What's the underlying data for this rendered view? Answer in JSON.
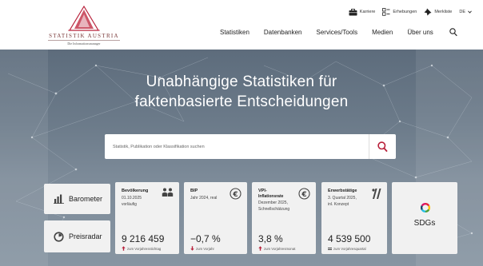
{
  "header": {
    "logo": {
      "wordmark": "STATISTIK AUSTRIA",
      "tagline": "Die Informationsmanager"
    },
    "utility": [
      {
        "label": "Karriere",
        "icon": "briefcase-icon"
      },
      {
        "label": "Erhebungen",
        "icon": "survey-icon"
      },
      {
        "label": "Merkliste",
        "icon": "pin-icon"
      },
      {
        "label": "DE",
        "icon": "chevron-down-icon"
      }
    ],
    "nav": [
      "Statistiken",
      "Datenbanken",
      "Services/Tools",
      "Medien",
      "Über uns"
    ],
    "search_icon": "search-icon"
  },
  "hero": {
    "title_line1": "Unabhängige Statistiken für",
    "title_line2": "faktenbasierte Entscheidungen",
    "search_placeholder": "Statistik, Publikation oder Klassifikation suchen"
  },
  "side_cards": {
    "barometer": {
      "label": "Barometer",
      "icon": "bar-chart-icon"
    },
    "preisradar": {
      "label": "Preisradar",
      "icon": "radar-icon"
    }
  },
  "kpis": [
    {
      "title": "Bevölkerung",
      "sub1": "01.10.2025",
      "sub2": "vorläufig",
      "sub3": "",
      "value": "9 216 459",
      "footer": "zum Vorjahresstichtag",
      "trend": "up",
      "icon": "people-icon"
    },
    {
      "title": "BIP",
      "sub1": "Jahr 2024, real",
      "sub2": "",
      "sub3": "",
      "value": "−0,7 %",
      "footer": "zum Vorjahr",
      "trend": "down",
      "icon": "euro-icon"
    },
    {
      "title": "VPI-",
      "sub1": "Inflationsrate",
      "sub2": "Dezember 2025,",
      "sub3": "Schnellschätzung",
      "value": "3,8 %",
      "footer": "zum Vorjahresmonat",
      "trend": "up",
      "icon": "euro-icon"
    },
    {
      "title": "Erwerbstätige",
      "sub1": "3. Quartal 2025,",
      "sub2": "inl. Konzept",
      "sub3": "",
      "value": "4 539 500",
      "footer": "zum Vorjahresquartal",
      "trend": "equal",
      "icon": "worker-icon"
    }
  ],
  "sdg": {
    "label": "SDGs",
    "icon": "sdg-wheel-icon"
  },
  "colors": {
    "accent": "#b8203a",
    "hero_top": "#5d6c7c",
    "card_bg": "#f1f1f1"
  }
}
